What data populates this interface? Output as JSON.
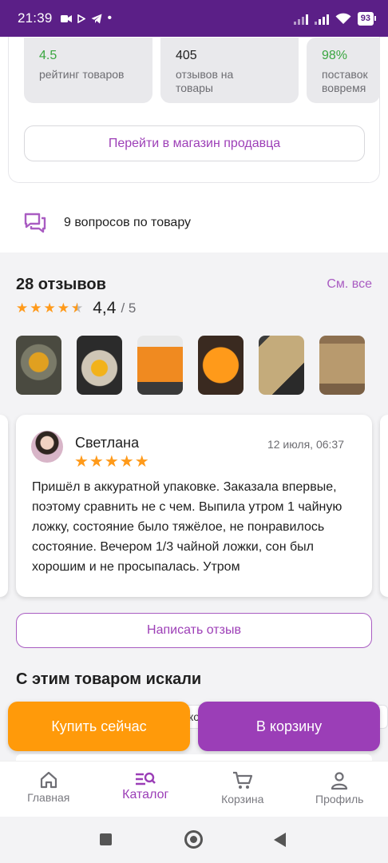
{
  "status_bar": {
    "time": "21:39",
    "battery": "93"
  },
  "seller": {
    "stats": [
      {
        "value": "4.5",
        "label": "рейтинг товаров"
      },
      {
        "value": "405",
        "label": "отзывов на товары"
      },
      {
        "value": "98%",
        "label": "поставок вовремя"
      }
    ],
    "shop_button": "Перейти в магазин продавца"
  },
  "questions": {
    "label": "9 вопросов по товару"
  },
  "reviews": {
    "title": "28 отзывов",
    "see_all": "См. все",
    "rating": 4.4,
    "rating_value": "4,4",
    "rating_max": "/ 5",
    "photos_count": 6,
    "card": {
      "author": "Светлана",
      "date": "12 июля, 06:37",
      "stars": 5,
      "stars_text": "★★★★★",
      "text": "Пришёл в аккуратной упаковке. Заказала впервые, поэтому сравнить не с чем. Выпила утром 1 чайную ложку, состояние было тяжёлое, не понравилось состояние. Вечером 1/3 чайной ложки, сон был хорошим и не просыпалась. Утром"
    },
    "write_button": "Написать отзыв"
  },
  "searched": {
    "title": "С этим товаром искали",
    "chip_text": "ко"
  },
  "actions": {
    "buy_now": "Купить сейчас",
    "add_to_cart": "В корзину"
  },
  "tabbar": {
    "items": [
      {
        "label": "Главная",
        "icon": "home-icon"
      },
      {
        "label": "Каталог",
        "icon": "catalog-search-icon",
        "active": true
      },
      {
        "label": "Корзина",
        "icon": "cart-icon"
      },
      {
        "label": "Профиль",
        "icon": "profile-icon"
      }
    ]
  },
  "colors": {
    "brand": "#5b1f87",
    "accent": "#9b3eb7",
    "orange": "#ff9a0a",
    "green": "#3aa640"
  }
}
